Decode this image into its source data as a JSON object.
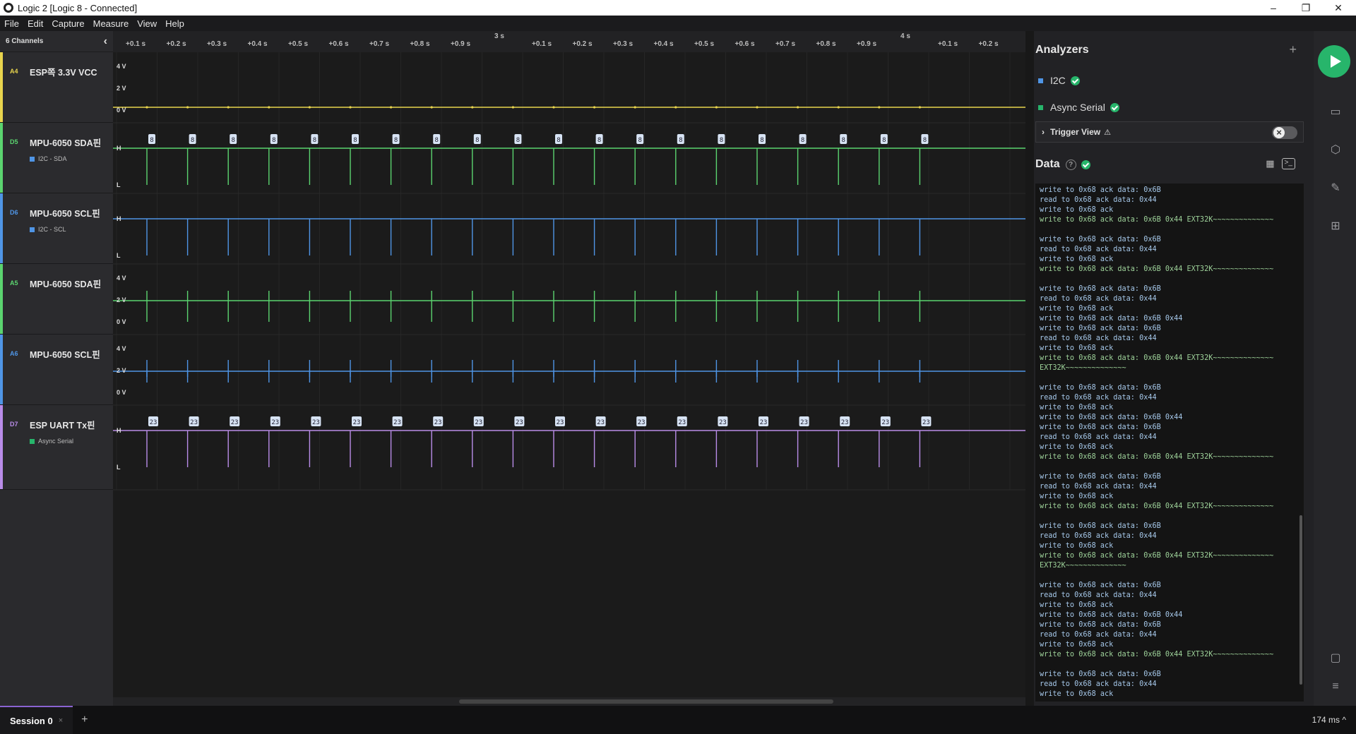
{
  "window": {
    "title": "Logic 2 [Logic 8 - Connected]",
    "minimize": "–",
    "maximize": "❐",
    "close": "✕"
  },
  "menu": [
    "File",
    "Edit",
    "Capture",
    "Measure",
    "View",
    "Help"
  ],
  "channels_header": {
    "label": "6 Channels",
    "collapse": "‹"
  },
  "channels": [
    {
      "id": "A4",
      "name": "ESP쪽 3.3V VCC",
      "analyzer": "",
      "color": "#e8d44d",
      "kind": "analog",
      "axis": [
        "4 V",
        "2 V",
        "0 V"
      ]
    },
    {
      "id": "D5",
      "name": "MPU-6050 SDA핀",
      "analyzer": "I2C - SDA",
      "color": "#5bd46f",
      "kind": "digital",
      "axis": [
        "H",
        "L"
      ]
    },
    {
      "id": "D6",
      "name": "MPU-6050 SCL핀",
      "analyzer": "I2C - SCL",
      "color": "#4f95e6",
      "kind": "digital",
      "axis": [
        "H",
        "L"
      ]
    },
    {
      "id": "A5",
      "name": "MPU-6050 SDA핀",
      "analyzer": "",
      "color": "#5bd46f",
      "kind": "analog",
      "axis": [
        "4 V",
        "2 V",
        "0 V"
      ]
    },
    {
      "id": "A6",
      "name": "MPU-6050 SCL핀",
      "analyzer": "",
      "color": "#4f95e6",
      "kind": "analog",
      "axis": [
        "4 V",
        "2 V",
        "0 V"
      ]
    },
    {
      "id": "D7",
      "name": "ESP UART Tx핀",
      "analyzer": "Async Serial",
      "color": "#b98ce8",
      "kind": "digital",
      "axis": [
        "H",
        "L"
      ]
    }
  ],
  "ruler": {
    "ticks": [
      "+0.1 s",
      "+0.2 s",
      "+0.3 s",
      "+0.4 s",
      "+0.5 s",
      "+0.6 s",
      "+0.7 s",
      "+0.8 s",
      "+0.9 s",
      "+0.1 s",
      "+0.2 s",
      "+0.3 s",
      "+0.4 s",
      "+0.5 s",
      "+0.6 s",
      "+0.7 s",
      "+0.8 s",
      "+0.9 s",
      "+0.1 s",
      "+0.2 s"
    ],
    "majors": [
      "3 s",
      "4 s"
    ]
  },
  "frame_labels": {
    "i2c": "8",
    "uart": "23"
  },
  "analyzers_panel": {
    "title": "Analyzers",
    "add": "+",
    "items": [
      {
        "name": "I2C",
        "color": "#4f95e6"
      },
      {
        "name": "Async Serial",
        "color": "#27b56b"
      }
    ],
    "trigger_view": "Trigger View"
  },
  "data_panel": {
    "title": "Data",
    "help": "?",
    "lines": [
      "write to 0x68 ack data: 0x6B",
      "read to 0x68 ack data: 0x44",
      "write to 0x68 ack",
      "write to 0x68 ack data: 0x6B 0x44 EXT32K~~~~~~~~~~~~~~",
      "",
      "write to 0x68 ack data: 0x6B",
      "read to 0x68 ack data: 0x44",
      "write to 0x68 ack",
      "write to 0x68 ack data: 0x6B 0x44 EXT32K~~~~~~~~~~~~~~",
      "",
      "write to 0x68 ack data: 0x6B",
      "read to 0x68 ack data: 0x44",
      "write to 0x68 ack",
      "write to 0x68 ack data: 0x6B 0x44",
      "write to 0x68 ack data: 0x6B",
      "read to 0x68 ack data: 0x44",
      "write to 0x68 ack",
      "write to 0x68 ack data: 0x6B 0x44 EXT32K~~~~~~~~~~~~~~",
      "EXT32K~~~~~~~~~~~~~~",
      "",
      "write to 0x68 ack data: 0x6B",
      "read to 0x68 ack data: 0x44",
      "write to 0x68 ack",
      "write to 0x68 ack data: 0x6B 0x44",
      "write to 0x68 ack data: 0x6B",
      "read to 0x68 ack data: 0x44",
      "write to 0x68 ack",
      "write to 0x68 ack data: 0x6B 0x44 EXT32K~~~~~~~~~~~~~~",
      "",
      "write to 0x68 ack data: 0x6B",
      "read to 0x68 ack data: 0x44",
      "write to 0x68 ack",
      "write to 0x68 ack data: 0x6B 0x44 EXT32K~~~~~~~~~~~~~~",
      "",
      "write to 0x68 ack data: 0x6B",
      "read to 0x68 ack data: 0x44",
      "write to 0x68 ack",
      "write to 0x68 ack data: 0x6B 0x44 EXT32K~~~~~~~~~~~~~~",
      "EXT32K~~~~~~~~~~~~~~",
      "",
      "write to 0x68 ack data: 0x6B",
      "read to 0x68 ack data: 0x44",
      "write to 0x68 ack",
      "write to 0x68 ack data: 0x6B 0x44",
      "write to 0x68 ack data: 0x6B",
      "read to 0x68 ack data: 0x44",
      "write to 0x68 ack",
      "write to 0x68 ack data: 0x6B 0x44 EXT32K~~~~~~~~~~~~~~",
      "",
      "write to 0x68 ack data: 0x6B",
      "read to 0x68 ack data: 0x44",
      "write to 0x68 ack"
    ]
  },
  "session": {
    "name": "Session 0",
    "close": "×",
    "add": "+"
  },
  "status": {
    "latency": "174 ms ^"
  }
}
